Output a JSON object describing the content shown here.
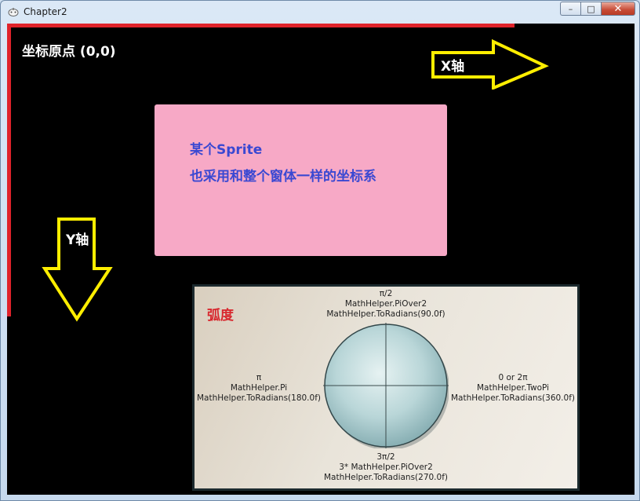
{
  "window": {
    "title": "Chapter2",
    "controls": {
      "minimize": "–",
      "maximize": "□",
      "close": "✕"
    }
  },
  "canvas": {
    "origin_label": "坐标原点 (0,0)",
    "x_axis_label": "X轴",
    "y_axis_label": "Y轴",
    "axis_color": "#e0232b",
    "arrow_color": "#ffee00"
  },
  "sprite": {
    "line1": "某个Sprite",
    "line2": "也采用和整个窗体一样的坐标系",
    "background": "#f7a9c6",
    "text_color": "#3a48d2"
  },
  "radians_diagram": {
    "title": "弧度",
    "top": {
      "symbol": "π/2",
      "line2": "MathHelper.PiOver2",
      "line3": "MathHelper.ToRadians(90.0f)"
    },
    "left": {
      "symbol": "π",
      "line2": "MathHelper.Pi",
      "line3": "MathHelper.ToRadians(180.0f)"
    },
    "right": {
      "symbol": "0 or 2π",
      "line2": "MathHelper.TwoPi",
      "line3": "MathHelper.ToRadians(360.0f)"
    },
    "bottom": {
      "symbol": "3π/2",
      "line2": "3* MathHelper.PiOver2",
      "line3": "MathHelper.ToRadians(270.0f)"
    }
  }
}
